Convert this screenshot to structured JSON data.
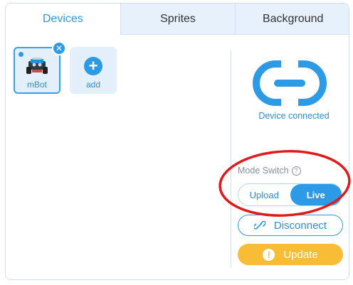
{
  "tabs": [
    {
      "label": "Devices",
      "active": true
    },
    {
      "label": "Sprites",
      "active": false
    },
    {
      "label": "Background",
      "active": false
    }
  ],
  "devices": [
    {
      "label": "mBot",
      "icon": "mbot-robot-icon",
      "selected": true
    }
  ],
  "add_tile": {
    "label": "add",
    "icon": "plus-icon"
  },
  "connection": {
    "icon": "link-icon",
    "status_text": "Device connected"
  },
  "mode_switch": {
    "label": "Mode Switch",
    "help_icon": "?",
    "options": [
      "Upload",
      "Live"
    ],
    "selected": "Live"
  },
  "buttons": {
    "disconnect_label": "Disconnect",
    "update_label": "Update",
    "update_icon_glyph": "!"
  },
  "colors": {
    "accent": "#2d9ae6",
    "tab_inactive_bg": "#e6f1fb",
    "update": "#f8bc36",
    "annotation_ellipse": "#e01a1a"
  }
}
